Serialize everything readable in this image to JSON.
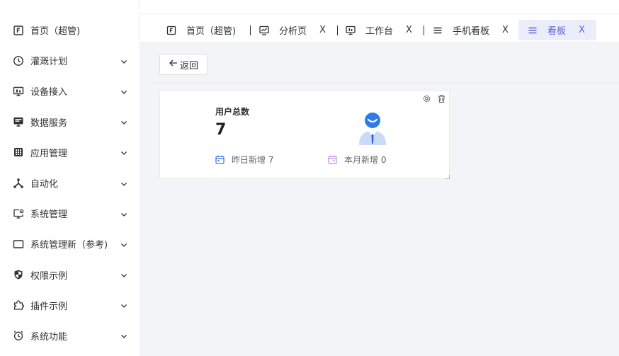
{
  "sidebar": {
    "items": [
      {
        "label": "首页（超管)",
        "icon": "home-icon",
        "has_children": false
      },
      {
        "label": "灌溉计划",
        "icon": "clock-icon",
        "has_children": true
      },
      {
        "label": "设备接入",
        "icon": "monitor-icon",
        "has_children": true
      },
      {
        "label": "数据服务",
        "icon": "data-screen-icon",
        "has_children": true
      },
      {
        "label": "应用管理",
        "icon": "grid-icon",
        "has_children": true
      },
      {
        "label": "自动化",
        "icon": "network-icon",
        "has_children": true
      },
      {
        "label": "系统管理",
        "icon": "monitor-settings-icon",
        "has_children": true
      },
      {
        "label": "系统管理新（参考)",
        "icon": "screen-icon",
        "has_children": true
      },
      {
        "label": "权限示例",
        "icon": "shield-icon",
        "has_children": true
      },
      {
        "label": "插件示例",
        "icon": "puzzle-icon",
        "has_children": true
      },
      {
        "label": "系统功能",
        "icon": "alarm-clock-icon",
        "has_children": true
      }
    ]
  },
  "tabs": [
    {
      "label": "首页（超管)",
      "icon": "home-icon",
      "closable": false,
      "active": false
    },
    {
      "label": "分析页",
      "icon": "chart-icon",
      "closable": true,
      "active": false
    },
    {
      "label": "工作台",
      "icon": "monitor-icon",
      "closable": true,
      "active": false
    },
    {
      "label": "手机看板",
      "icon": "menu-icon",
      "closable": true,
      "active": false
    },
    {
      "label": "看板",
      "icon": "menu-icon",
      "closable": true,
      "active": true
    }
  ],
  "tab_close_glyph": "X",
  "content": {
    "back_label": "返回",
    "card": {
      "title": "用户总数",
      "value": "7",
      "stat_yesterday": "昨日新增 7",
      "stat_month": "本月新增 0"
    }
  },
  "colors": {
    "accent": "#5a66d8",
    "active_tab_bg": "#ecedfb",
    "calendar_blue": "#3f79e8",
    "calendar_purple": "#b98ee8"
  }
}
